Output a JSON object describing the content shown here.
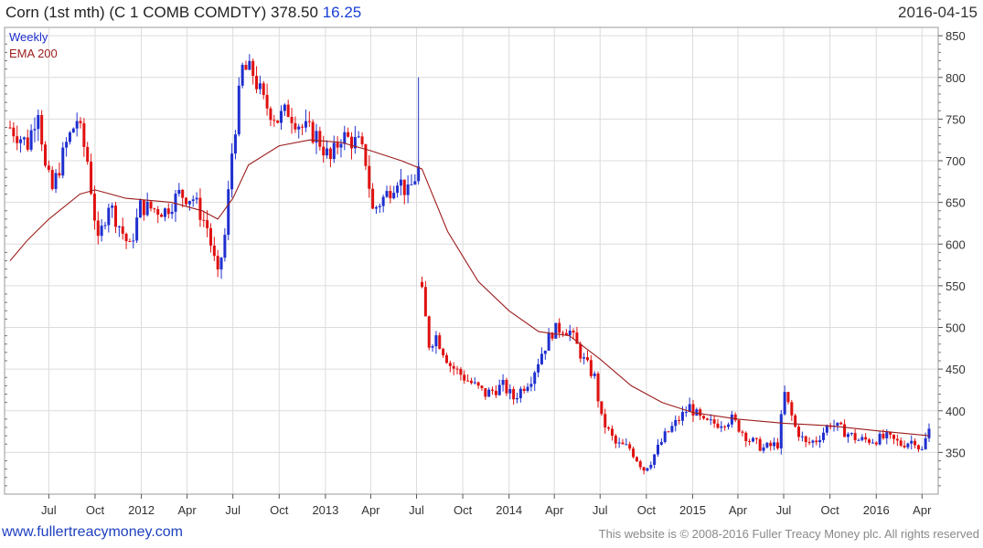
{
  "header": {
    "title": "Corn (1st mth) (C 1 COMB COMDTY) 378.50",
    "change": "16.25",
    "date": "2016-04-15"
  },
  "footer": {
    "site": "www.fullertreacymoney.com",
    "copyright": "This website is © 2008-2016 Fuller Treacy Money plc. All rights reserved"
  },
  "colors": {
    "up": "#1f2fcf",
    "down": "#e01010",
    "ema": "#9c1c1c",
    "grid": "#dcdcdc"
  },
  "chart_data": {
    "type": "candlestick",
    "legend": [
      "Weekly",
      "EMA 200"
    ],
    "legend_position": "top-left",
    "grid": true,
    "y_axis_side": "right",
    "ylim": [
      300,
      860
    ],
    "yticks": [
      350,
      400,
      450,
      500,
      550,
      600,
      650,
      700,
      750,
      800,
      850
    ],
    "x_range": [
      "2011-04-15",
      "2016-04-15"
    ],
    "xticks": [
      {
        "label": "Jul",
        "date": "2011-07-01"
      },
      {
        "label": "Oct",
        "date": "2011-10-01"
      },
      {
        "label": "2012",
        "date": "2012-01-01"
      },
      {
        "label": "Apr",
        "date": "2012-04-01"
      },
      {
        "label": "Jul",
        "date": "2012-07-01"
      },
      {
        "label": "Oct",
        "date": "2012-10-01"
      },
      {
        "label": "2013",
        "date": "2013-01-01"
      },
      {
        "label": "Apr",
        "date": "2013-04-01"
      },
      {
        "label": "Jul",
        "date": "2013-07-01"
      },
      {
        "label": "Oct",
        "date": "2013-10-01"
      },
      {
        "label": "2014",
        "date": "2014-01-01"
      },
      {
        "label": "Apr",
        "date": "2014-04-01"
      },
      {
        "label": "Jul",
        "date": "2014-07-01"
      },
      {
        "label": "Oct",
        "date": "2014-10-01"
      },
      {
        "label": "2015",
        "date": "2015-01-01"
      },
      {
        "label": "Apr",
        "date": "2015-04-01"
      },
      {
        "label": "Jul",
        "date": "2015-07-01"
      },
      {
        "label": "Oct",
        "date": "2015-10-01"
      },
      {
        "label": "2016",
        "date": "2016-01-01"
      },
      {
        "label": "Apr",
        "date": "2016-04-01"
      }
    ],
    "close_anchors": [
      [
        "2011-04-15",
        740
      ],
      [
        "2011-05-20",
        720
      ],
      [
        "2011-06-10",
        765
      ],
      [
        "2011-06-24",
        690
      ],
      [
        "2011-07-08",
        665
      ],
      [
        "2011-08-05",
        720
      ],
      [
        "2011-08-26",
        750
      ],
      [
        "2011-09-16",
        700
      ],
      [
        "2011-10-07",
        600
      ],
      [
        "2011-10-28",
        650
      ],
      [
        "2011-12-09",
        595
      ],
      [
        "2011-12-30",
        645
      ],
      [
        "2012-02-17",
        640
      ],
      [
        "2012-03-16",
        660
      ],
      [
        "2012-04-13",
        655
      ],
      [
        "2012-05-11",
        620
      ],
      [
        "2012-06-01",
        560
      ],
      [
        "2012-06-15",
        610
      ],
      [
        "2012-06-29",
        710
      ],
      [
        "2012-07-20",
        810
      ],
      [
        "2012-08-10",
        805
      ],
      [
        "2012-08-31",
        770
      ],
      [
        "2012-09-28",
        750
      ],
      [
        "2012-10-19",
        760
      ],
      [
        "2012-11-16",
        740
      ],
      [
        "2012-12-14",
        730
      ],
      [
        "2013-01-11",
        700
      ],
      [
        "2013-02-01",
        730
      ],
      [
        "2013-03-08",
        720
      ],
      [
        "2013-03-22",
        700
      ],
      [
        "2013-04-05",
        640
      ],
      [
        "2013-05-03",
        660
      ],
      [
        "2013-05-24",
        680
      ],
      [
        "2013-06-14",
        660
      ],
      [
        "2013-07-05",
        690
      ],
      [
        "2013-07-12",
        540
      ],
      [
        "2013-07-26",
        480
      ],
      [
        "2013-08-09",
        490
      ],
      [
        "2013-09-06",
        455
      ],
      [
        "2013-10-04",
        440
      ],
      [
        "2013-11-15",
        420
      ],
      [
        "2013-12-20",
        430
      ],
      [
        "2014-01-10",
        415
      ],
      [
        "2014-02-14",
        440
      ],
      [
        "2014-03-07",
        470
      ],
      [
        "2014-03-28",
        495
      ],
      [
        "2014-04-18",
        500
      ],
      [
        "2014-05-02",
        495
      ],
      [
        "2014-05-30",
        460
      ],
      [
        "2014-06-20",
        440
      ],
      [
        "2014-07-04",
        390
      ],
      [
        "2014-08-01",
        360
      ],
      [
        "2014-08-29",
        355
      ],
      [
        "2014-09-26",
        330
      ],
      [
        "2014-10-10",
        340
      ],
      [
        "2014-11-07",
        370
      ],
      [
        "2014-12-05",
        390
      ],
      [
        "2014-12-26",
        405
      ],
      [
        "2015-01-23",
        385
      ],
      [
        "2015-02-20",
        385
      ],
      [
        "2015-03-20",
        390
      ],
      [
        "2015-04-24",
        365
      ],
      [
        "2015-05-22",
        355
      ],
      [
        "2015-06-19",
        360
      ],
      [
        "2015-07-03",
        420
      ],
      [
        "2015-07-24",
        380
      ],
      [
        "2015-08-14",
        360
      ],
      [
        "2015-09-04",
        365
      ],
      [
        "2015-10-02",
        385
      ],
      [
        "2015-10-30",
        375
      ],
      [
        "2015-11-27",
        365
      ],
      [
        "2015-12-25",
        365
      ],
      [
        "2016-01-22",
        368
      ],
      [
        "2016-02-19",
        360
      ],
      [
        "2016-03-18",
        365
      ],
      [
        "2016-03-31",
        350
      ],
      [
        "2016-04-15",
        378.5
      ]
    ],
    "ema_200": [
      [
        "2011-04-15",
        580
      ],
      [
        "2011-05-20",
        605
      ],
      [
        "2011-07-01",
        630
      ],
      [
        "2011-09-01",
        660
      ],
      [
        "2011-10-01",
        665
      ],
      [
        "2011-12-01",
        655
      ],
      [
        "2012-03-01",
        650
      ],
      [
        "2012-05-01",
        640
      ],
      [
        "2012-06-01",
        630
      ],
      [
        "2012-07-01",
        655
      ],
      [
        "2012-08-01",
        695
      ],
      [
        "2012-10-01",
        718
      ],
      [
        "2012-12-01",
        725
      ],
      [
        "2013-02-01",
        722
      ],
      [
        "2013-04-01",
        712
      ],
      [
        "2013-06-01",
        700
      ],
      [
        "2013-07-12",
        690
      ],
      [
        "2013-09-01",
        615
      ],
      [
        "2013-11-01",
        555
      ],
      [
        "2014-01-01",
        520
      ],
      [
        "2014-03-01",
        495
      ],
      [
        "2014-05-01",
        490
      ],
      [
        "2014-07-01",
        462
      ],
      [
        "2014-09-01",
        430
      ],
      [
        "2014-11-01",
        410
      ],
      [
        "2015-01-01",
        398
      ],
      [
        "2015-04-01",
        390
      ],
      [
        "2015-07-01",
        385
      ],
      [
        "2015-10-01",
        382
      ],
      [
        "2016-01-01",
        376
      ],
      [
        "2016-04-15",
        370
      ]
    ]
  }
}
